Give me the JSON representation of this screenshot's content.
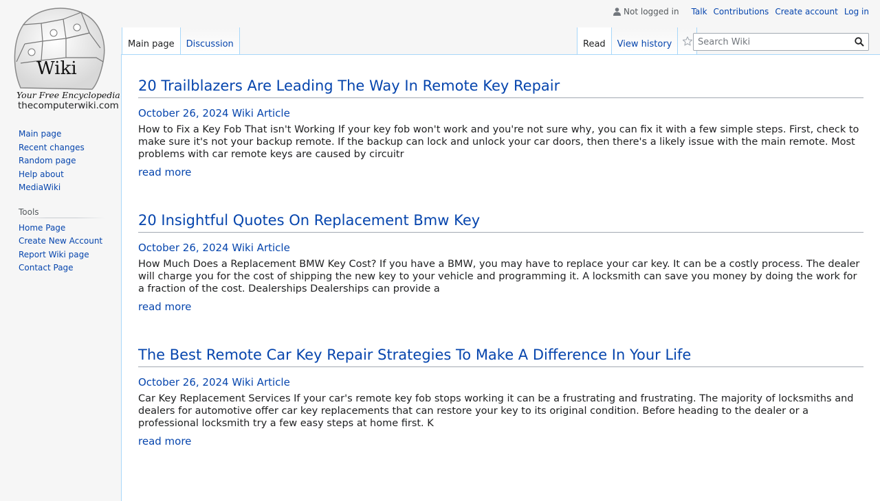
{
  "logo": {
    "wordmark": "Wiki",
    "tagline": "Your Free Encyclopedia",
    "site": "thecomputerwiki.com"
  },
  "personal": {
    "status": "Not logged in",
    "links": [
      "Talk",
      "Contributions",
      "Create account",
      "Log in"
    ]
  },
  "tabs": {
    "left": [
      "Main page",
      "Discussion"
    ],
    "right": [
      "Read",
      "View history"
    ]
  },
  "search": {
    "placeholder": "Search Wiki"
  },
  "sidebar": {
    "nav": [
      "Main page",
      "Recent changes",
      "Random page",
      "Help about MediaWiki"
    ],
    "tools_title": "Tools",
    "tools": [
      "Home Page",
      "Create New Account",
      "Report Wiki page",
      "Contact Page"
    ]
  },
  "articles": [
    {
      "title": "20 Trailblazers Are Leading The Way In Remote Key Repair",
      "date": "October 26, 2024",
      "category": "Wiki Article",
      "excerpt": "How to Fix a Key Fob That isn't Working If your key fob won't work and you're not sure why, you can fix it with a few simple steps. First, check to make sure it's not your backup remote. If the backup can lock and unlock your car doors, then there's a likely issue with the main remote. Most problems with car remote keys are caused by circuitr",
      "read_more": "read more"
    },
    {
      "title": "20 Insightful Quotes On Replacement Bmw Key",
      "date": "October 26, 2024",
      "category": "Wiki Article",
      "excerpt": "How Much Does a Replacement BMW Key Cost? If you have a BMW, you may have to replace your car key. It can be a costly process. The dealer will charge you for the cost of shipping the new key to your vehicle and programming it. A locksmith can save you money by doing the work for a fraction of the cost. Dealerships Dealerships can provide a",
      "read_more": "read more"
    },
    {
      "title": "The Best Remote Car Key Repair Strategies To Make A Difference In Your Life",
      "date": "October 26, 2024",
      "category": "Wiki Article",
      "excerpt": "Car Key Replacement Services If your car's remote key fob stops working it can be a frustrating and frustrating. The majority of locksmiths and dealers for automotive offer car key replacements that can restore your key to its original condition. Before heading to the dealer or a professional locksmith try a few easy steps at home first. K",
      "read_more": "read more"
    }
  ]
}
